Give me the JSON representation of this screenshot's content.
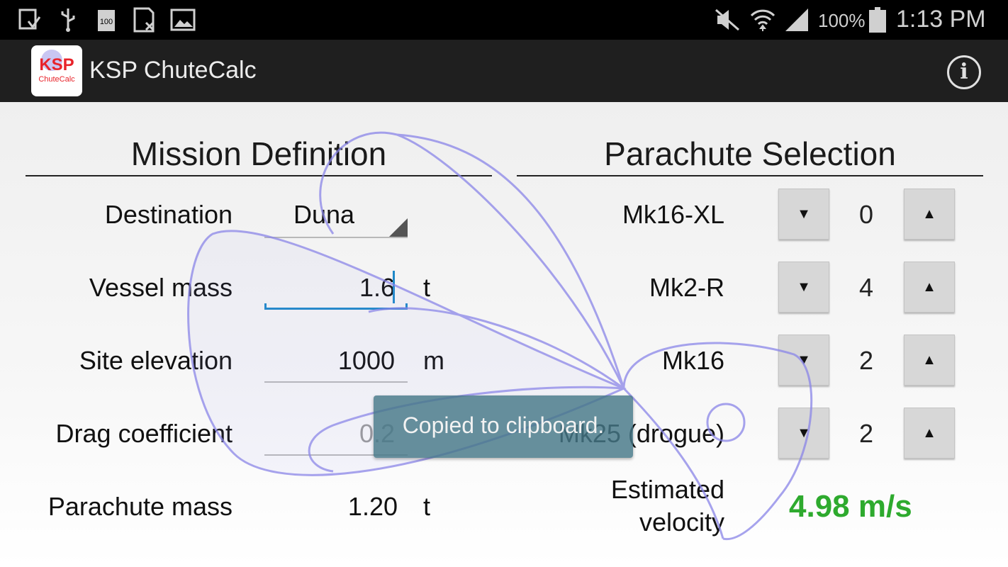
{
  "status_bar": {
    "icons": [
      "screenshot-icon",
      "usb-icon",
      "battery-100-icon",
      "sim-icon",
      "image-icon"
    ],
    "right_icons": [
      "mute-icon",
      "wifi-icon",
      "signal-icon",
      "battery-icon"
    ],
    "battery_percent": "100%",
    "time": "1:13 PM"
  },
  "action_bar": {
    "logo_text": "KSP",
    "logo_subtext": "ChuteCalc",
    "title": "KSP ChuteCalc",
    "info_icon": "info-icon",
    "info_glyph": "i"
  },
  "mission": {
    "title": "Mission Definition",
    "destination_label": "Destination",
    "destination_value": "Duna",
    "vessel_mass_label": "Vessel mass",
    "vessel_mass_value": "1.6",
    "vessel_mass_unit": "t",
    "site_elevation_label": "Site elevation",
    "site_elevation_value": "1000",
    "site_elevation_unit": "m",
    "drag_coefficient_label": "Drag coefficient",
    "drag_coefficient_value": "0.2",
    "parachute_mass_label": "Parachute mass",
    "parachute_mass_value": "1.20",
    "parachute_mass_unit": "t"
  },
  "parachutes": {
    "title": "Parachute Selection",
    "decrement_glyph": "▼",
    "increment_glyph": "▲",
    "items": [
      {
        "name": "Mk16-XL",
        "count": "0"
      },
      {
        "name": "Mk2-R",
        "count": "4"
      },
      {
        "name": "Mk16",
        "count": "2"
      },
      {
        "name": "Mk25 (drogue)",
        "count": "2"
      }
    ],
    "estimated_label_line1": "Estimated",
    "estimated_label_line2": "velocity",
    "estimated_value": "4.98 m/s"
  },
  "toast": {
    "text": "Copied to clipboard."
  },
  "colors": {
    "velocity": "#2eaa2e",
    "field_active": "#1e88c8",
    "logo_red": "#e8232a",
    "watermark": "#8a85e8"
  }
}
